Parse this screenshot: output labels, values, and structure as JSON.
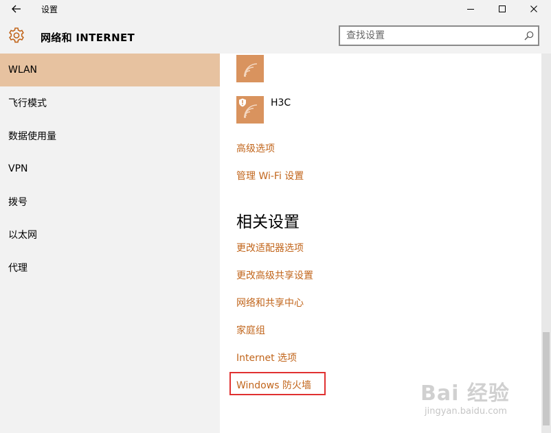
{
  "window": {
    "title": "设置",
    "back_icon": "arrow-left-icon",
    "controls": [
      "minimize-icon",
      "maximize-icon",
      "close-icon"
    ]
  },
  "header": {
    "app_icon": "gear-icon",
    "title": "网络和 INTERNET",
    "search": {
      "placeholder": "查找设置",
      "value": "",
      "icon": "search-icon"
    }
  },
  "sidebar": {
    "items": [
      {
        "label": "WLAN",
        "selected": true
      },
      {
        "label": "飞行模式",
        "selected": false
      },
      {
        "label": "数据使用量",
        "selected": false
      },
      {
        "label": "VPN",
        "selected": false
      },
      {
        "label": "拨号",
        "selected": false
      },
      {
        "label": "以太网",
        "selected": false
      },
      {
        "label": "代理",
        "selected": false
      }
    ]
  },
  "content": {
    "networks": [
      {
        "name": "",
        "icon": "wifi-signal-icon",
        "secured": false
      },
      {
        "name": "H3C",
        "icon": "wifi-signal-icon",
        "secured": true
      }
    ],
    "links": {
      "advanced_options": "高级选项",
      "manage_wifi": "管理 Wi-Fi 设置"
    },
    "related": {
      "heading": "相关设置",
      "links": [
        "更改适配器选项",
        "更改高级共享设置",
        "网络和共享中心",
        "家庭组",
        "Internet 选项",
        "Windows 防火墙"
      ],
      "highlighted": "Windows 防火墙"
    }
  },
  "watermark": {
    "logo": "Bai 经验",
    "url": "jingyan.baidu.com"
  },
  "colors": {
    "accent": "#c1651b",
    "selected_nav": "#e7c2a0",
    "tile": "#d9935e",
    "highlight_border": "#e03030"
  }
}
